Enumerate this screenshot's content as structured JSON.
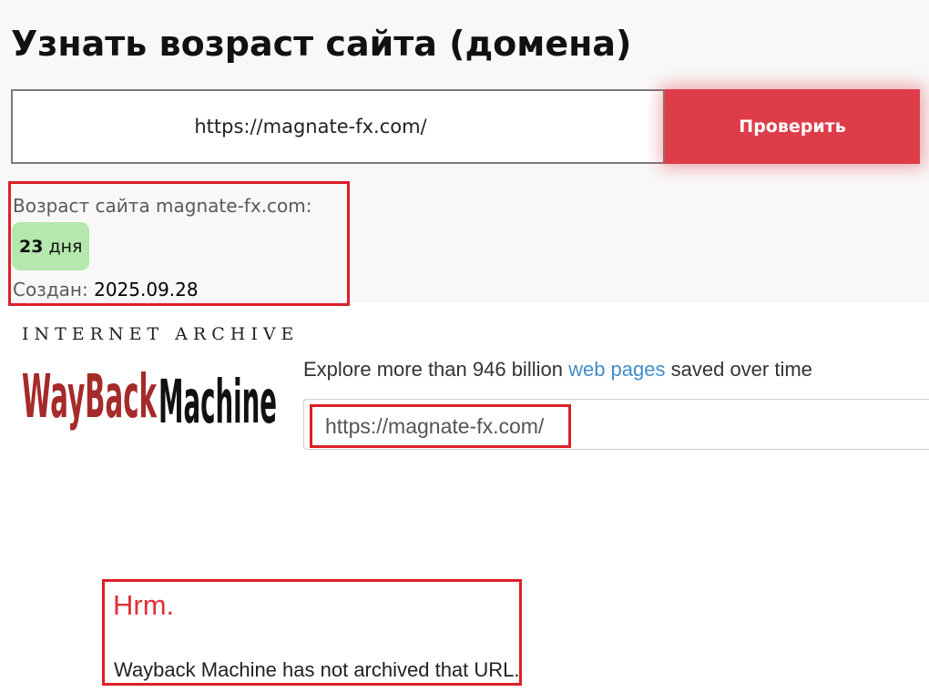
{
  "checker": {
    "title": "Узнать возраст сайта (домена)",
    "input_value": "https://magnate-fx.com/",
    "button_label": "Проверить",
    "age_label": "Возраст сайта magnate-fx.com:",
    "age_number": "23",
    "age_unit": "дня",
    "created_label": "Создан:",
    "created_date": "2025.09.28"
  },
  "wayback": {
    "brand_top": "INTERNET ARCHIVE",
    "logo_word_1": "WayBack",
    "logo_word_2": "Machine",
    "tagline_before": "Explore more than 946 billion",
    "tagline_link": "web pages",
    "tagline_after": "saved over time",
    "search_value": "https://magnate-fx.com/",
    "hrm_title": "Hrm.",
    "hrm_message": "Wayback Machine has not archived that URL."
  },
  "colors": {
    "accent_red": "#df3c49",
    "highlight_border": "#dc1f27",
    "age_badge": "#b4e8ad",
    "wayback_red": "#a52a2a",
    "link_blue": "#428bca"
  }
}
